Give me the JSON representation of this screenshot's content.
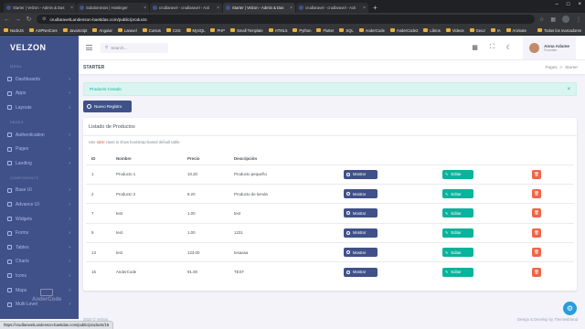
{
  "browser": {
    "tabs": [
      {
        "title": "Starter | Velzon - Admin & Das",
        "active": false
      },
      {
        "title": "Subdominios | Hostinger",
        "active": false
      },
      {
        "title": "crudlaravel - crudlaravel - Acti",
        "active": false
      },
      {
        "title": "Starter | Velzon - Admin & Das",
        "active": true
      },
      {
        "title": "crudlaravel - crudlaravel - Acti",
        "active": false
      }
    ],
    "url": "crudlaravelLandenson-baetidas.com/public/products",
    "bookmarks": [
      "NodeJS",
      "ASPNetCore",
      "JavaScript",
      "Angular",
      "Laravel",
      "Cursos",
      "CSS",
      "MySQL",
      "PHP",
      "Small Template",
      "HTML5",
      "Python",
      "Flutter",
      "SQL",
      "AnderCode",
      "AnderCode2",
      "Libros",
      "Videos",
      "GeoJ",
      "IA",
      "Animate"
    ],
    "bookmarks_right": "Todos los marcadores",
    "status_url": "https://crudlaravelLandenson-baetidas.com/public/products/16"
  },
  "app": {
    "logo": "VELZON",
    "watermark": "AnderCode",
    "sidebar": {
      "sections": [
        {
          "title": "MENU",
          "items": [
            {
              "label": "Dashboards",
              "icon": "dashboard-icon"
            },
            {
              "label": "Apps",
              "icon": "apps-icon"
            },
            {
              "label": "Layouts",
              "icon": "layouts-icon"
            }
          ]
        },
        {
          "title": "PAGES",
          "items": [
            {
              "label": "Authentication",
              "icon": "account-icon"
            },
            {
              "label": "Pages",
              "icon": "pages-icon"
            },
            {
              "label": "Landing",
              "icon": "rocket-icon"
            }
          ]
        },
        {
          "title": "COMPONENTS",
          "items": [
            {
              "label": "Base UI",
              "icon": "pencil-ruler-icon"
            },
            {
              "label": "Advance UI",
              "icon": "stack-icon"
            },
            {
              "label": "Widgets",
              "icon": "honour-icon"
            },
            {
              "label": "Forms",
              "icon": "file-list-icon"
            },
            {
              "label": "Tables",
              "icon": "layout-grid-icon"
            },
            {
              "label": "Charts",
              "icon": "pie-chart-icon"
            },
            {
              "label": "Icons",
              "icon": "compasses-icon"
            },
            {
              "label": "Maps",
              "icon": "map-pin-icon"
            },
            {
              "label": "Multi Level",
              "icon": "share-line-icon"
            }
          ]
        }
      ]
    },
    "topbar": {
      "search_placeholder": "Search...",
      "user_name": "Anna Adame",
      "user_role": "Founder"
    },
    "page_title": "STARTER",
    "breadcrumb": [
      "Pages",
      ">",
      "Starter"
    ],
    "alert_text": "Producto Creado",
    "new_button": "Nuevo Registro",
    "card_title": "Listado de Productos",
    "hint": {
      "prefix": "Use ",
      "code": "table",
      "suffix": " class to show bootstrap-based default table."
    },
    "table": {
      "headers": [
        "ID",
        "Nombre",
        "Precio",
        "Descripción",
        "",
        "",
        ""
      ],
      "rows": [
        [
          "1",
          "Producto 1",
          "10.20",
          "Producto pequeño"
        ],
        [
          "2",
          "Producto 2",
          "8.20",
          "Producto de tienda"
        ],
        [
          "7",
          "test",
          "1.00",
          "test"
        ],
        [
          "9",
          "test",
          "1.00",
          "1231"
        ],
        [
          "13",
          "test",
          "123.00",
          "tesaasa"
        ],
        [
          "16",
          "AnderCode",
          "91.00",
          "TEST"
        ]
      ],
      "show_label": "Mostrar",
      "edit_label": "Editar"
    },
    "footer_left": "2024 © Velzon.",
    "footer_right": "Design & Develop by Themesbrand"
  }
}
